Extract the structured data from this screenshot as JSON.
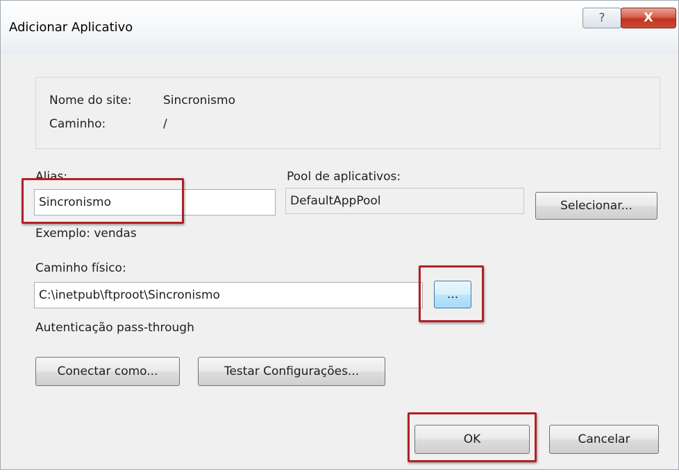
{
  "window": {
    "title": "Adicionar Aplicativo",
    "help_label": "?",
    "close_label": "X"
  },
  "site_info": {
    "site_name_label": "Nome do site:",
    "site_name_value": "Sincronismo",
    "path_label": "Caminho:",
    "path_value": "/"
  },
  "alias": {
    "label": "Alias:",
    "value": "Sincronismo",
    "example": "Exemplo: vendas"
  },
  "app_pool": {
    "label": "Pool de aplicativos:",
    "value": "DefaultAppPool",
    "select_button": "Selecionar..."
  },
  "physical_path": {
    "label": "Caminho físico:",
    "value": "C:\\inetpub\\ftproot\\Sincronismo",
    "browse_button": "..."
  },
  "auth": {
    "label": "Autenticação pass-through",
    "connect_as_button": "Conectar como...",
    "test_settings_button": "Testar Configurações..."
  },
  "footer": {
    "ok_button": "OK",
    "cancel_button": "Cancelar"
  },
  "colors": {
    "highlight_border": "#b21f24",
    "close_button": "#c94c35",
    "dialog_background": "#f0f0f0"
  }
}
